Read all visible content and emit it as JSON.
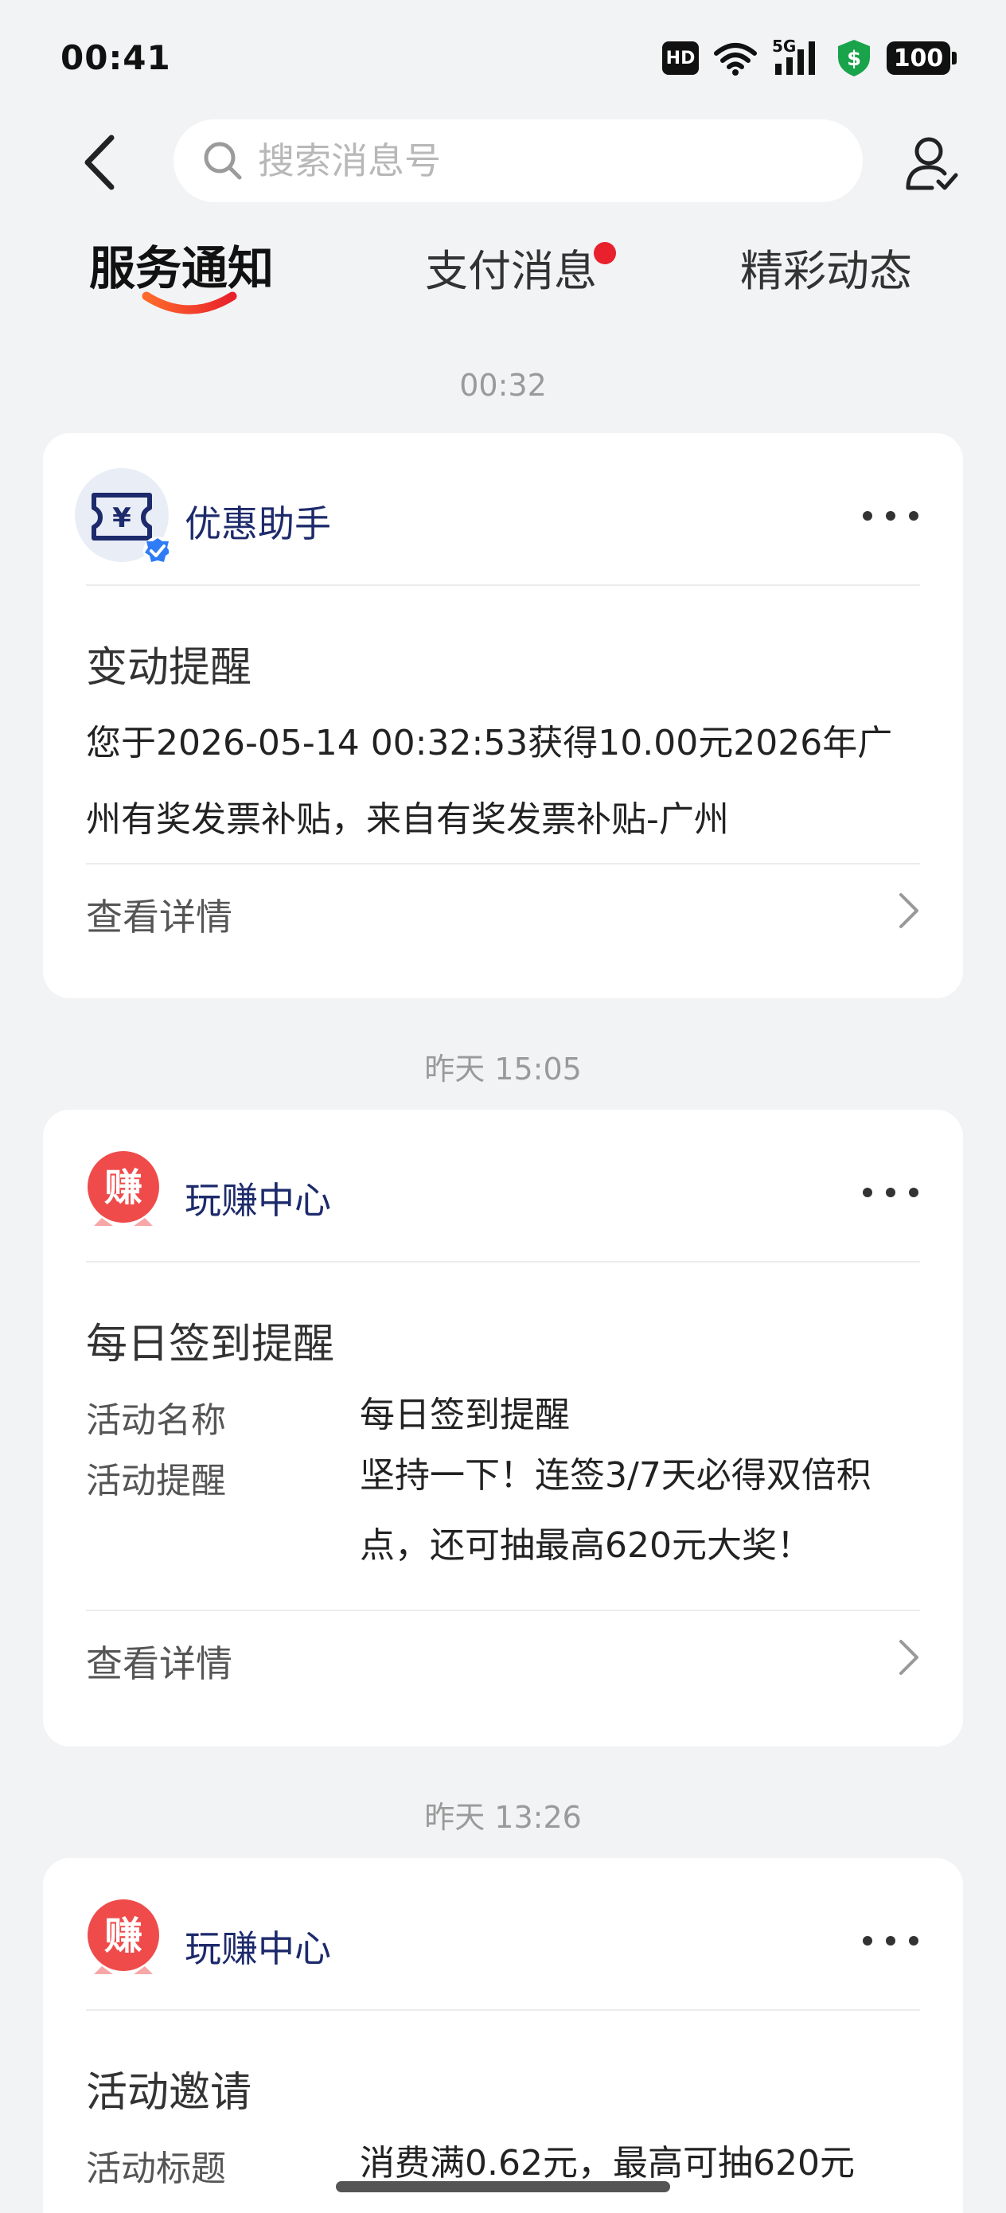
{
  "status_bar": {
    "time": "00:41",
    "hd": "HD",
    "network": "5G",
    "battery": "100"
  },
  "header": {
    "search_placeholder": "搜索消息号"
  },
  "tabs": [
    {
      "label": "服务通知",
      "active": true
    },
    {
      "label": "支付消息",
      "badge": true
    },
    {
      "label": "精彩动态"
    }
  ],
  "feed": [
    {
      "time": "00:32",
      "sender": "优惠助手",
      "title": "变动提醒",
      "body": "您于2026-05-14 00:32:53获得10.00元2026年广州有奖发票补贴，来自有奖发票补贴-广州",
      "detail_label": "查看详情"
    },
    {
      "time": "昨天 15:05",
      "sender": "玩赚中心",
      "avatar_char": "赚",
      "title": "每日签到提醒",
      "fields": [
        {
          "key": "活动名称",
          "value": "每日签到提醒"
        },
        {
          "key": "活动提醒",
          "value": "坚持一下！连签3/7天必得双倍积点，还可抽最高620元大奖！"
        }
      ],
      "detail_label": "查看详情"
    },
    {
      "time": "昨天 13:26",
      "sender": "玩赚中心",
      "avatar_char": "赚",
      "title": "活动邀请",
      "fields": [
        {
          "key": "活动标题",
          "value": "消费满0.62元，最高可抽620元"
        }
      ]
    }
  ],
  "colors": {
    "background": "#f2f3f5",
    "sender_text": "#1d2a6b",
    "badge_red": "#e8212c",
    "earn_red": "#ef4b4b",
    "verified_blue": "#2f7cf6"
  }
}
